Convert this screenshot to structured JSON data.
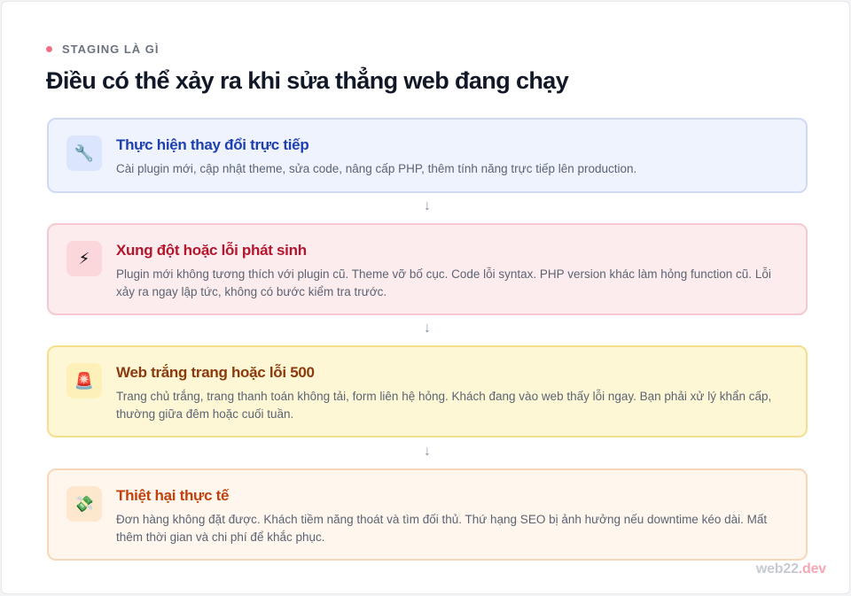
{
  "eyebrow": "STAGING LÀ GÌ",
  "title": "Điều có thể xảy ra khi sửa thẳng web đang chạy",
  "steps": [
    {
      "icon": "wrench-icon",
      "glyph": "🔧",
      "title": "Thực hiện thay đổi trực tiếp",
      "desc": "Cài plugin mới, cập nhật theme, sửa code, nâng cấp PHP, thêm tính năng trực tiếp lên production."
    },
    {
      "icon": "lightning-icon",
      "glyph": "⚡",
      "title": "Xung đột hoặc lỗi phát sinh",
      "desc": "Plugin mới không tương thích với plugin cũ. Theme vỡ bố cục. Code lỗi syntax. PHP version khác làm hỏng function cũ. Lỗi xảy ra ngay lập tức, không có bước kiểm tra trước."
    },
    {
      "icon": "siren-icon",
      "glyph": "🚨",
      "title": "Web trắng trang hoặc lỗi 500",
      "desc": "Trang chủ trắng, trang thanh toán không tải, form liên hệ hỏng. Khách đang vào web thấy lỗi ngay. Bạn phải xử lý khẩn cấp, thường giữa đêm hoặc cuối tuần."
    },
    {
      "icon": "money-icon",
      "glyph": "💸",
      "title": "Thiệt hại thực tế",
      "desc": "Đơn hàng không đặt được. Khách tiềm năng thoát và tìm đối thủ. Thứ hạng SEO bị ảnh hưởng nếu downtime kéo dài. Mất thêm thời gian và chi phí để khắc phục."
    }
  ],
  "arrow_glyph": "↓",
  "brand": {
    "part1": "web22",
    "part2": ".dev"
  }
}
